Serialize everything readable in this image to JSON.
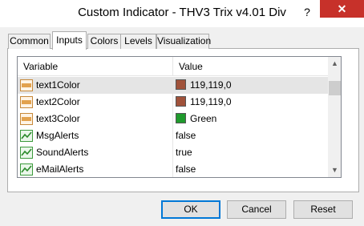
{
  "window": {
    "title": "Custom Indicator - THV3 Trix v4.01 Div",
    "help_label": "?",
    "close_label": "✕"
  },
  "tabs": [
    {
      "label": "Common"
    },
    {
      "label": "Inputs"
    },
    {
      "label": "Colors"
    },
    {
      "label": "Levels"
    },
    {
      "label": "Visualization"
    }
  ],
  "grid": {
    "columns": {
      "variable": "Variable",
      "value": "Value"
    },
    "rows": [
      {
        "name": "text1Color",
        "value": "119,119,0",
        "icon": "color-param-icon",
        "swatch": "#a0523a"
      },
      {
        "name": "text2Color",
        "value": "119,119,0",
        "icon": "color-param-icon",
        "swatch": "#a0523a"
      },
      {
        "name": "text3Color",
        "value": "Green",
        "icon": "color-param-icon",
        "swatch": "#1f9a2c"
      },
      {
        "name": "MsgAlerts",
        "value": "false",
        "icon": "bool-param-icon"
      },
      {
        "name": "SoundAlerts",
        "value": "true",
        "icon": "bool-param-icon"
      },
      {
        "name": "eMailAlerts",
        "value": "false",
        "icon": "bool-param-icon"
      }
    ]
  },
  "buttons": {
    "ok": "OK",
    "cancel": "Cancel",
    "reset": "Reset"
  },
  "colors": {
    "close_bg": "#c7312a",
    "selection": "#e5e5e5",
    "focus": "#0078d7"
  }
}
